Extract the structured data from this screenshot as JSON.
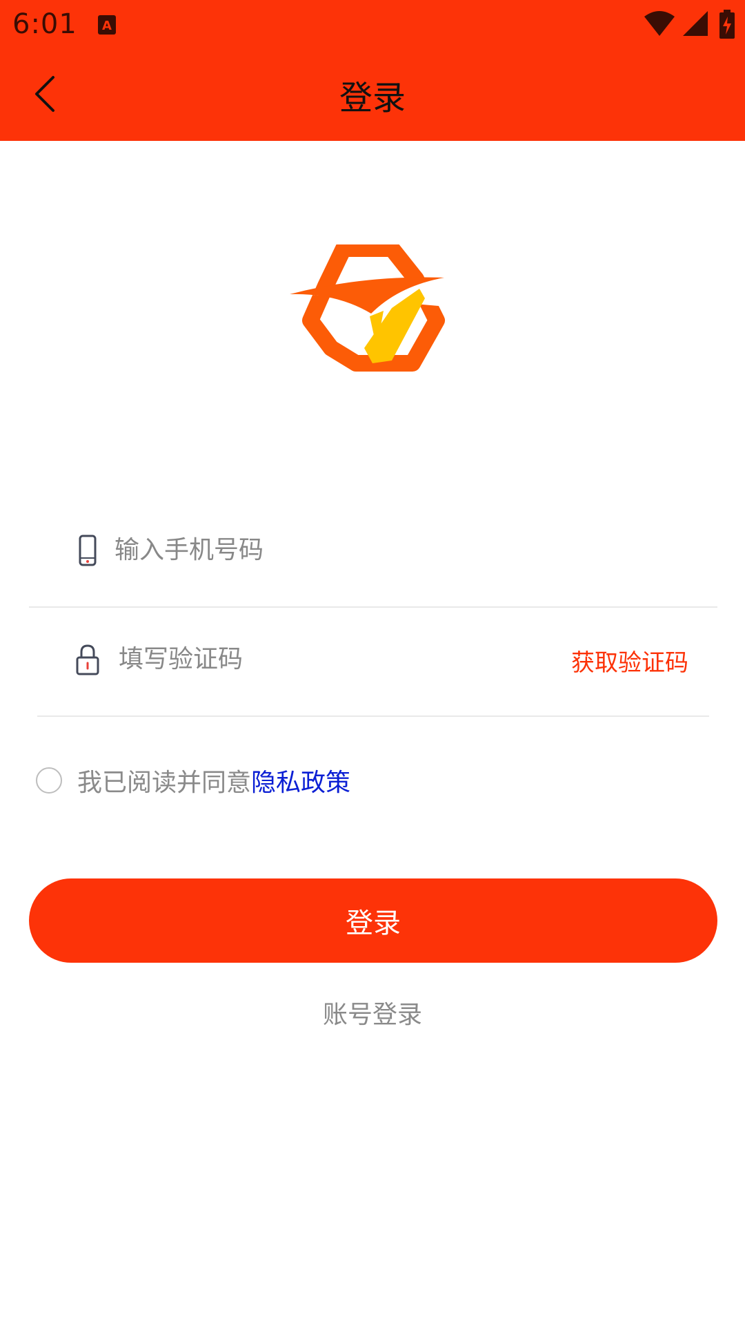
{
  "status_bar": {
    "time": "6:01",
    "icons": [
      "app-notification-icon",
      "wifi-icon",
      "cell-signal-icon",
      "battery-charging-icon"
    ]
  },
  "toolbar": {
    "title": "登录",
    "back_icon": "chevron-left-icon"
  },
  "logo": {
    "name": "app-logo",
    "colors": {
      "orange": "#fc5c07",
      "yellow": "#ffc400"
    }
  },
  "form": {
    "phone": {
      "placeholder": "输入手机号码",
      "value": "",
      "icon": "phone-icon"
    },
    "code": {
      "placeholder": "填写验证码",
      "value": "",
      "icon": "lock-icon"
    },
    "get_code_label": "获取验证码"
  },
  "agreement": {
    "checked": false,
    "text": "我已阅读并同意",
    "link_text": "隐私政策"
  },
  "login_button_label": "登录",
  "account_login_label": "账号登录",
  "colors": {
    "brand": "#fd3308",
    "link": "#0b1fd4",
    "muted_text": "#8a8a8a"
  }
}
